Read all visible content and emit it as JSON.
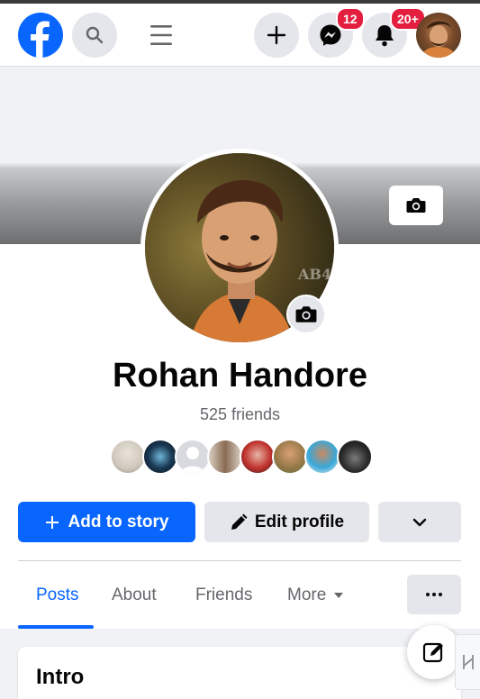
{
  "header": {
    "logo_icon": "facebook-logo-icon",
    "search_icon": "search-icon",
    "menu_icon": "menu-icon",
    "create_icon": "plus-icon",
    "messenger_icon": "messenger-icon",
    "messenger_badge": "12",
    "notifications_icon": "bell-icon",
    "notifications_badge": "20+",
    "brand_color": "#0866ff",
    "badge_color": "#e41e3f"
  },
  "profile": {
    "name": "Rohan Handore",
    "friends_count": "525 friends",
    "photo_watermark": "AB4",
    "friend_avatars": [
      "friend-1",
      "friend-2",
      "friend-3",
      "friend-4",
      "friend-5",
      "friend-6",
      "friend-7",
      "friend-8"
    ]
  },
  "actions": {
    "add_story_label": "Add to story",
    "edit_profile_label": "Edit profile"
  },
  "tabs": [
    {
      "label": "Posts",
      "active": true
    },
    {
      "label": "About",
      "active": false
    },
    {
      "label": "Friends",
      "active": false
    },
    {
      "label": "More",
      "active": false
    }
  ],
  "intro": {
    "title": "Intro"
  }
}
